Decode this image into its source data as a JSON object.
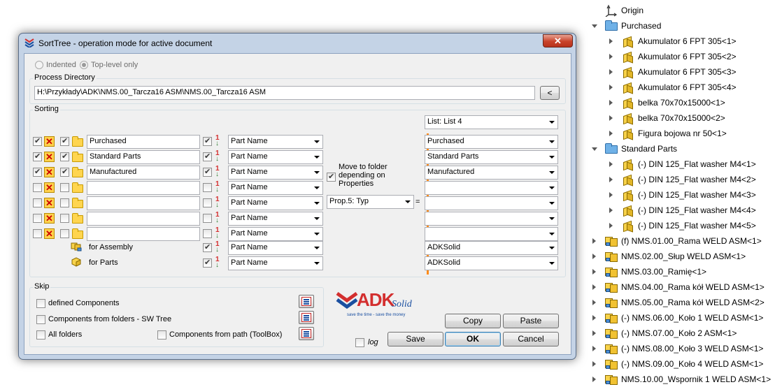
{
  "dialog": {
    "title": "SortTree - operation mode for active document",
    "close": "✕",
    "mode": {
      "indented": "Indented",
      "top_level": "Top-level only"
    },
    "process_directory": {
      "label": "Process Directory",
      "value": "H:\\Przykłady\\ADK\\NMS.00_Tarcza16 ASM\\NMS.00_Tarcza16 ASM",
      "button": "<"
    },
    "sorting": {
      "label": "Sorting",
      "list_select": "List: List 4",
      "rows": [
        {
          "enabled": true,
          "folder_checked": true,
          "name": "Purchased",
          "sort_checked": true,
          "sort_by": "Part Name",
          "target": "Purchased"
        },
        {
          "enabled": true,
          "folder_checked": true,
          "name": "Standard Parts",
          "sort_checked": true,
          "sort_by": "Part Name",
          "target": "Standard Parts"
        },
        {
          "enabled": true,
          "folder_checked": true,
          "name": "Manufactured",
          "sort_checked": true,
          "sort_by": "Part Name",
          "target": "Manufactured"
        },
        {
          "enabled": false,
          "folder_checked": false,
          "name": "",
          "sort_checked": false,
          "sort_by": "Part Name",
          "target": ""
        },
        {
          "enabled": false,
          "folder_checked": false,
          "name": "",
          "sort_checked": false,
          "sort_by": "Part Name",
          "target": ""
        },
        {
          "enabled": false,
          "folder_checked": false,
          "name": "",
          "sort_checked": false,
          "sort_by": "Part Name",
          "target": ""
        },
        {
          "enabled": false,
          "folder_checked": false,
          "name": "",
          "sort_checked": false,
          "sort_by": "Part Name",
          "target": ""
        }
      ],
      "for_assembly": {
        "label": "for Assembly",
        "sort_by": "Part Name",
        "target": "ADKSolid"
      },
      "for_parts": {
        "label": "for Parts",
        "sort_by": "Part Name",
        "target": "ADKSolid"
      },
      "move_to_folder": "Move to folder depending on Properties",
      "property": "Prop.5: Typ",
      "equals": "="
    },
    "skip": {
      "label": "Skip",
      "defined_components": "defined Components",
      "components_from_folders": "Components from folders - SW Tree",
      "all_folders": "All folders",
      "components_from_path": "Components from path (ToolBox)"
    },
    "logo": {
      "main": "ADK",
      "sub": "Solid",
      "tagline": "save the time - save the money"
    },
    "log_label": "log",
    "buttons": {
      "copy": "Copy",
      "paste": "Paste",
      "save": "Save",
      "ok": "OK",
      "cancel": "Cancel"
    }
  },
  "tree": {
    "items": [
      {
        "label": "Origin",
        "type": "origin",
        "level": 0,
        "expander": "none"
      },
      {
        "label": "Purchased",
        "type": "folder",
        "level": 0,
        "expander": "open"
      },
      {
        "label": "Akumulator 6 FPT 305<1>",
        "type": "part",
        "level": 1,
        "expander": "closed"
      },
      {
        "label": "Akumulator 6 FPT 305<2>",
        "type": "part",
        "level": 1,
        "expander": "closed"
      },
      {
        "label": "Akumulator 6 FPT 305<3>",
        "type": "part",
        "level": 1,
        "expander": "closed"
      },
      {
        "label": "Akumulator 6 FPT 305<4>",
        "type": "part",
        "level": 1,
        "expander": "closed"
      },
      {
        "label": "belka 70x70x15000<1>",
        "type": "part",
        "level": 1,
        "expander": "closed"
      },
      {
        "label": "belka 70x70x15000<2>",
        "type": "part",
        "level": 1,
        "expander": "closed"
      },
      {
        "label": "Figura bojowa nr 50<1>",
        "type": "part",
        "level": 1,
        "expander": "closed"
      },
      {
        "label": "Standard Parts",
        "type": "folder",
        "level": 0,
        "expander": "open"
      },
      {
        "label": "(-) DIN 125_Flat washer M4<1>",
        "type": "part",
        "level": 1,
        "expander": "closed"
      },
      {
        "label": "(-) DIN 125_Flat washer M4<2>",
        "type": "part",
        "level": 1,
        "expander": "closed"
      },
      {
        "label": "(-) DIN 125_Flat washer M4<3>",
        "type": "part",
        "level": 1,
        "expander": "closed"
      },
      {
        "label": "(-) DIN 125_Flat washer M4<4>",
        "type": "part",
        "level": 1,
        "expander": "closed"
      },
      {
        "label": "(-) DIN 125_Flat washer M4<5>",
        "type": "part",
        "level": 1,
        "expander": "closed"
      },
      {
        "label": "(f) NMS.01.00_Rama WELD ASM<1>",
        "type": "assembly",
        "level": 0,
        "expander": "closed"
      },
      {
        "label": "NMS.02.00_Słup WELD ASM<1>",
        "type": "assembly",
        "level": 0,
        "expander": "closed"
      },
      {
        "label": "NMS.03.00_Ramię<1>",
        "type": "assembly",
        "level": 0,
        "expander": "closed"
      },
      {
        "label": "NMS.04.00_Rama kół WELD ASM<1>",
        "type": "assembly",
        "level": 0,
        "expander": "closed"
      },
      {
        "label": "NMS.05.00_Rama kół WELD ASM<2>",
        "type": "assembly",
        "level": 0,
        "expander": "closed"
      },
      {
        "label": "(-) NMS.06.00_Koło 1 WELD ASM<1>",
        "type": "assembly",
        "level": 0,
        "expander": "closed"
      },
      {
        "label": "(-) NMS.07.00_Koło 2 ASM<1>",
        "type": "assembly",
        "level": 0,
        "expander": "closed"
      },
      {
        "label": "(-) NMS.08.00_Koło 3 WELD ASM<1>",
        "type": "assembly",
        "level": 0,
        "expander": "closed"
      },
      {
        "label": "(-) NMS.09.00_Koło 4 WELD ASM<1>",
        "type": "assembly",
        "level": 0,
        "expander": "closed"
      },
      {
        "label": "NMS.10.00_Wspornik 1 WELD ASM<1>",
        "type": "assembly",
        "level": 0,
        "expander": "closed"
      }
    ]
  }
}
